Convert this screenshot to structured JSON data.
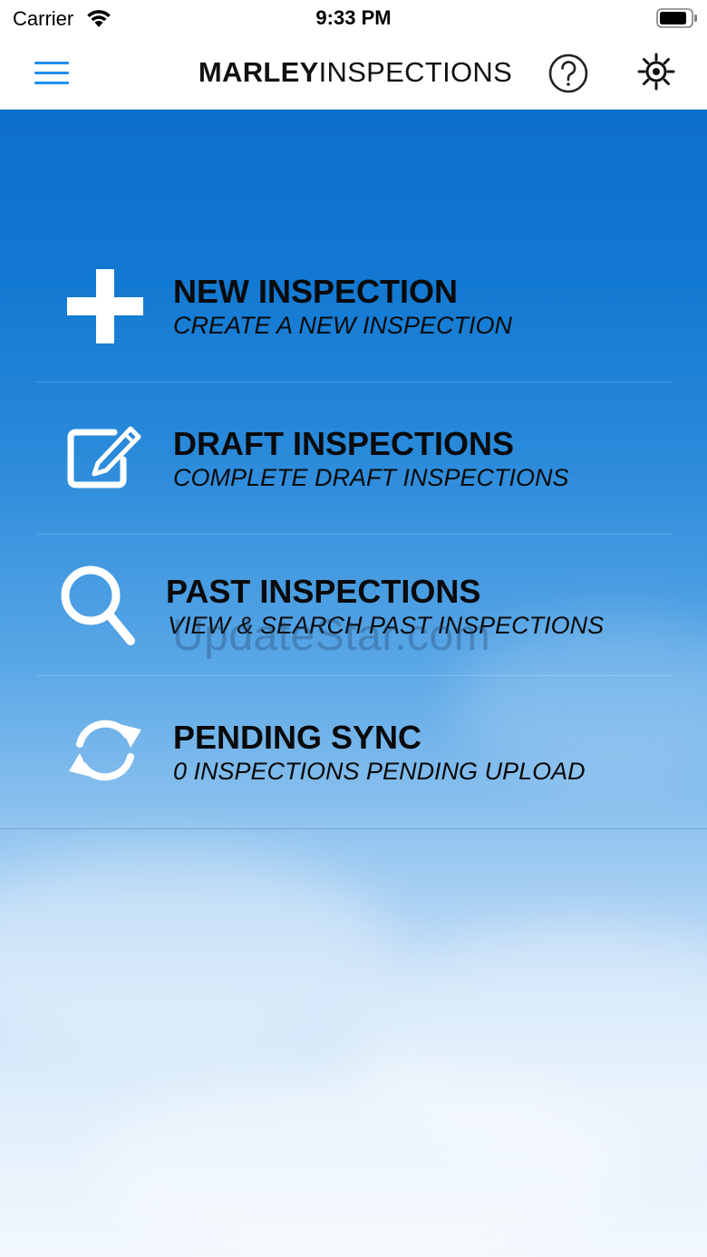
{
  "status_bar": {
    "carrier": "Carrier",
    "time": "9:33 PM"
  },
  "nav": {
    "brand_bold": "MARLEY",
    "brand_light": "INSPECTIONS",
    "icons": {
      "menu": "hamburger-menu-icon",
      "help": "help-circle-icon",
      "settings": "gear-icon"
    },
    "accent_color": "#1f8ff0"
  },
  "menu": {
    "items": [
      {
        "title": "NEW INSPECTION",
        "subtitle": "CREATE A NEW INSPECTION",
        "icon": "plus-icon"
      },
      {
        "title": "DRAFT INSPECTIONS",
        "subtitle": "COMPLETE DRAFT INSPECTIONS",
        "icon": "edit-icon"
      },
      {
        "title": "PAST INSPECTIONS",
        "subtitle": "VIEW & SEARCH PAST INSPECTIONS",
        "icon": "search-icon"
      },
      {
        "title": "PENDING SYNC",
        "subtitle": "0 INSPECTIONS PENDING UPLOAD",
        "icon": "sync-icon"
      }
    ]
  },
  "watermark": "UpdateStar.com"
}
